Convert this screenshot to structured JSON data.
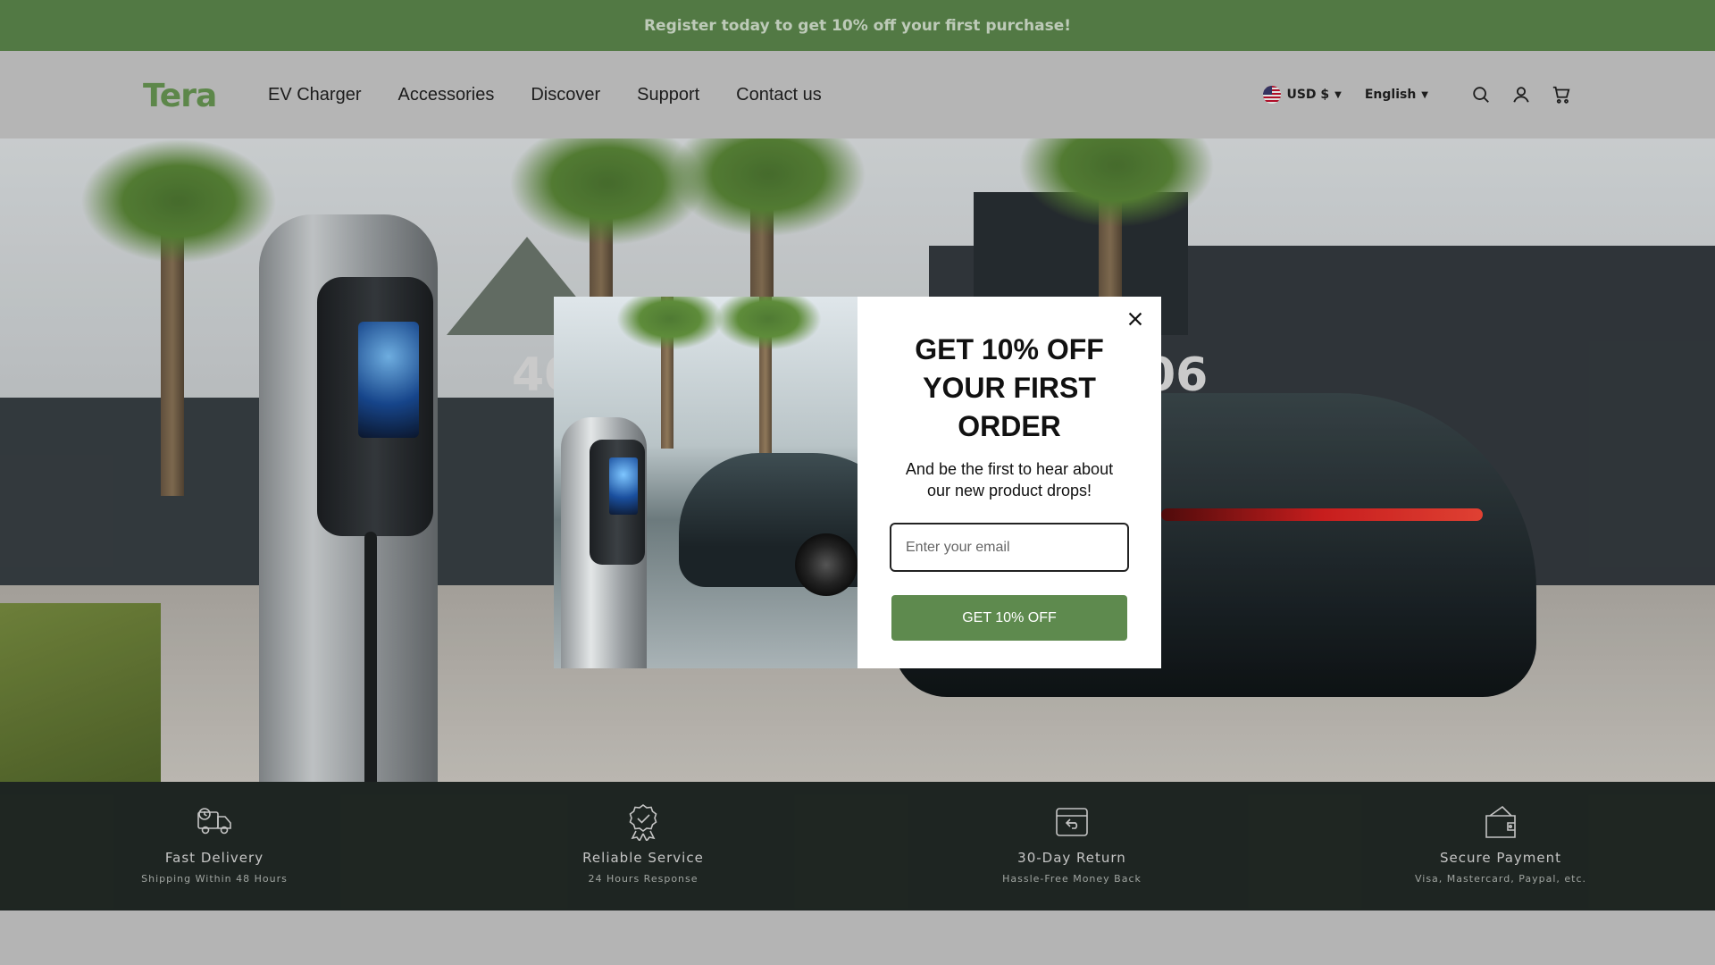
{
  "announcement": {
    "text": "Register today to get 10% off your first purchase!"
  },
  "header": {
    "logo": "Tera",
    "nav": [
      "EV Charger",
      "Accessories",
      "Discover",
      "Support",
      "Contact us"
    ],
    "currency": "USD $",
    "language": "English",
    "icons": [
      "search-icon",
      "account-icon",
      "cart-icon"
    ]
  },
  "hero": {
    "headline_left": "40",
    "headline_right": "06"
  },
  "features": [
    {
      "icon": "delivery-truck-icon",
      "title": "Fast Delivery",
      "subtitle": "Shipping Within 48 Hours"
    },
    {
      "icon": "award-badge-icon",
      "title": "Reliable Service",
      "subtitle": "24 Hours Response"
    },
    {
      "icon": "return-box-icon",
      "title": "30-Day Return",
      "subtitle": "Hassle-Free Money Back"
    },
    {
      "icon": "wallet-icon",
      "title": "Secure Payment",
      "subtitle": "Visa, Mastercard, Paypal, etc."
    }
  ],
  "popup": {
    "title": "GET 10% OFF YOUR FIRST ORDER",
    "subtitle": "And be the first to hear about our new product drops!",
    "email_placeholder": "Enter your email",
    "button_label": "GET 10% OFF"
  },
  "colors": {
    "brand_green": "#5e8a4e",
    "logo_green": "#6a9a55",
    "feature_bar": "#232b27"
  }
}
